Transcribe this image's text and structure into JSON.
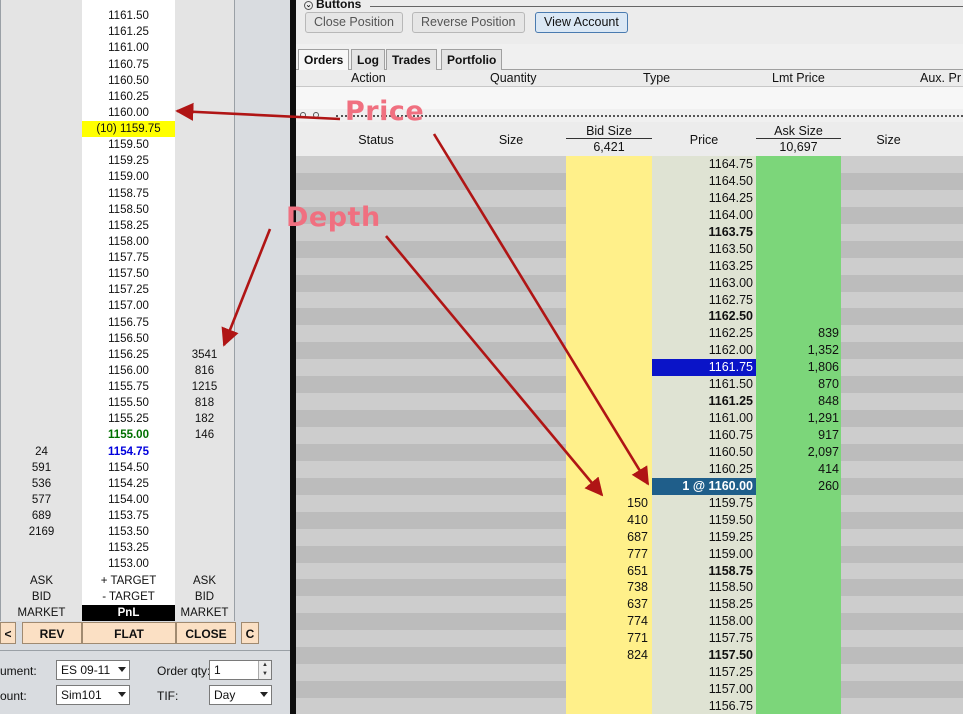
{
  "ladder": {
    "rows": [
      {
        "left": "",
        "price": "",
        "right": ""
      },
      {
        "left": "",
        "price": "1161.50",
        "right": ""
      },
      {
        "left": "",
        "price": "1161.25",
        "right": ""
      },
      {
        "left": "",
        "price": "1161.00",
        "right": ""
      },
      {
        "left": "",
        "price": "1160.75",
        "right": ""
      },
      {
        "left": "",
        "price": "1160.50",
        "right": ""
      },
      {
        "left": "",
        "price": "1160.25",
        "right": ""
      },
      {
        "left": "",
        "price": "1160.00",
        "right": ""
      },
      {
        "left": "",
        "price": "(10) 1159.75",
        "right": "",
        "style": "lastp"
      },
      {
        "left": "",
        "price": "1159.50",
        "right": ""
      },
      {
        "left": "",
        "price": "1159.25",
        "right": ""
      },
      {
        "left": "",
        "price": "1159.00",
        "right": ""
      },
      {
        "left": "",
        "price": "1158.75",
        "right": ""
      },
      {
        "left": "",
        "price": "1158.50",
        "right": ""
      },
      {
        "left": "",
        "price": "1158.25",
        "right": ""
      },
      {
        "left": "",
        "price": "1158.00",
        "right": ""
      },
      {
        "left": "",
        "price": "1157.75",
        "right": ""
      },
      {
        "left": "",
        "price": "1157.50",
        "right": ""
      },
      {
        "left": "",
        "price": "1157.25",
        "right": ""
      },
      {
        "left": "",
        "price": "1157.00",
        "right": ""
      },
      {
        "left": "",
        "price": "1156.75",
        "right": ""
      },
      {
        "left": "",
        "price": "1156.50",
        "right": ""
      },
      {
        "left": "",
        "price": "1156.25",
        "right": "3541"
      },
      {
        "left": "",
        "price": "1156.00",
        "right": "816"
      },
      {
        "left": "",
        "price": "1155.75",
        "right": "1215"
      },
      {
        "left": "",
        "price": "1155.50",
        "right": "818"
      },
      {
        "left": "",
        "price": "1155.25",
        "right": "182"
      },
      {
        "left": "",
        "price": "1155.00",
        "right": "146",
        "style": "grn"
      },
      {
        "left": "24",
        "price": "1154.75",
        "right": "",
        "style": "blu"
      },
      {
        "left": "591",
        "price": "1154.50",
        "right": ""
      },
      {
        "left": "536",
        "price": "1154.25",
        "right": ""
      },
      {
        "left": "577",
        "price": "1154.00",
        "right": ""
      },
      {
        "left": "689",
        "price": "1153.75",
        "right": ""
      },
      {
        "left": "2169",
        "price": "1153.50",
        "right": ""
      },
      {
        "left": "",
        "price": "1153.25",
        "right": ""
      },
      {
        "left": "",
        "price": "1153.00",
        "right": ""
      },
      {
        "left": "ASK",
        "price": "+ TARGET",
        "right": "ASK"
      },
      {
        "left": "BID",
        "price": "- TARGET",
        "right": "BID"
      },
      {
        "left": "MARKET",
        "price": "PnL",
        "right": "MARKET",
        "style": "pnl"
      }
    ],
    "buttons": {
      "left": "<",
      "rev": "REV",
      "flat": "FLAT",
      "close": "CLOSE",
      "c": "C"
    },
    "form": {
      "instrument_label": "ument:",
      "instrument_value": "ES 09-11",
      "account_label": "ount:",
      "account_value": "Sim101",
      "order_qty_label": "Order qty:",
      "order_qty_value": "1",
      "tif_label": "TIF:",
      "tif_value": "Day"
    }
  },
  "buttons_panel": {
    "title": "Buttons",
    "close_position": "Close Position",
    "reverse_position": "Reverse Position",
    "view_account": "View Account"
  },
  "tabs": [
    "Orders",
    "Log",
    "Trades",
    "Portfolio"
  ],
  "orders_header": {
    "action": "Action",
    "quantity": "Quantity",
    "type": "Type",
    "lmt_price": "Lmt Price",
    "aux": "Aux. Pr"
  },
  "depth_header": {
    "status": "Status",
    "size": "Size",
    "bid_size": "Bid Size",
    "bid_total": "6,421",
    "price": "Price",
    "ask_size": "Ask Size",
    "ask_total": "10,697",
    "size2": "Size"
  },
  "depth": [
    {
      "bid": "",
      "price": "1164.75",
      "ask": ""
    },
    {
      "bid": "",
      "price": "1164.50",
      "ask": ""
    },
    {
      "bid": "",
      "price": "1164.25",
      "ask": ""
    },
    {
      "bid": "",
      "price": "1164.00",
      "ask": ""
    },
    {
      "bid": "",
      "price": "1163.75",
      "ask": "",
      "bold": true
    },
    {
      "bid": "",
      "price": "1163.50",
      "ask": ""
    },
    {
      "bid": "",
      "price": "1163.25",
      "ask": ""
    },
    {
      "bid": "",
      "price": "1163.00",
      "ask": ""
    },
    {
      "bid": "",
      "price": "1162.75",
      "ask": ""
    },
    {
      "bid": "",
      "price": "1162.50",
      "ask": "",
      "bold": true
    },
    {
      "bid": "",
      "price": "1162.25",
      "ask": "839"
    },
    {
      "bid": "",
      "price": "1162.00",
      "ask": "1,352"
    },
    {
      "bid": "",
      "price": "1161.75",
      "ask": "1,806",
      "hl": "last"
    },
    {
      "bid": "",
      "price": "1161.50",
      "ask": "870"
    },
    {
      "bid": "",
      "price": "1161.25",
      "ask": "848",
      "bold": true
    },
    {
      "bid": "",
      "price": "1161.00",
      "ask": "1,291"
    },
    {
      "bid": "",
      "price": "1160.75",
      "ask": "917"
    },
    {
      "bid": "",
      "price": "1160.50",
      "ask": "2,097"
    },
    {
      "bid": "",
      "price": "1160.25",
      "ask": "414"
    },
    {
      "bid": "",
      "price": "1 @ 1160.00",
      "ask": "260",
      "hl": "pos"
    },
    {
      "bid": "150",
      "price": "1159.75",
      "ask": ""
    },
    {
      "bid": "410",
      "price": "1159.50",
      "ask": ""
    },
    {
      "bid": "687",
      "price": "1159.25",
      "ask": ""
    },
    {
      "bid": "777",
      "price": "1159.00",
      "ask": ""
    },
    {
      "bid": "651",
      "price": "1158.75",
      "ask": "",
      "bold": true
    },
    {
      "bid": "738",
      "price": "1158.50",
      "ask": ""
    },
    {
      "bid": "637",
      "price": "1158.25",
      "ask": ""
    },
    {
      "bid": "774",
      "price": "1158.00",
      "ask": ""
    },
    {
      "bid": "771",
      "price": "1157.75",
      "ask": ""
    },
    {
      "bid": "824",
      "price": "1157.50",
      "ask": "",
      "bold": true
    },
    {
      "bid": "",
      "price": "1157.25",
      "ask": ""
    },
    {
      "bid": "",
      "price": "1157.00",
      "ask": ""
    },
    {
      "bid": "",
      "price": "1156.75",
      "ask": ""
    }
  ],
  "annotations": {
    "price": "Price",
    "depth": "Depth"
  },
  "colors": {
    "annotation": "#f07080",
    "arrow": "#b01515",
    "bid": "#fff08a",
    "ask": "#7cd67a",
    "last_price": "#0a14c8",
    "position": "#1f5e8a"
  }
}
